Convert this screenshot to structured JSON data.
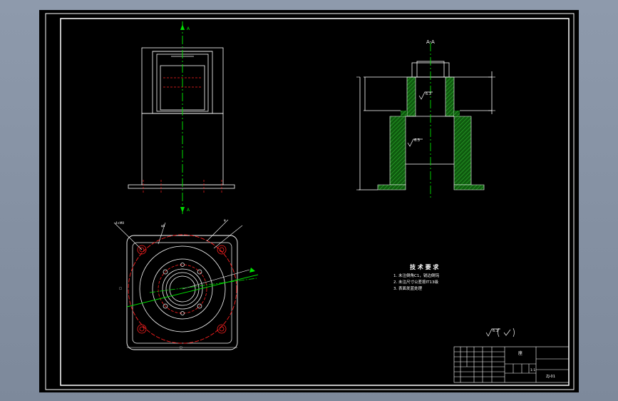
{
  "section_label": "A-A",
  "roughness_section": "6.3",
  "roughness_main": "6.3",
  "roughness_inner": "6.3",
  "default_roughness": "6.3",
  "tech_title": "技 术 要 求",
  "tech_lines": [
    "1. 未注倒角C1，锐边倒钝",
    "2. 未注尺寸公差按IT13级",
    "3. 表面发蓝处理"
  ],
  "title_block": {
    "part_name": "座",
    "scale": "1:1",
    "drawing_no": "ZJ-01"
  },
  "colors": {
    "background": "#000000",
    "outline": "#ffffff",
    "centerline": "#00ff00",
    "hidden": "#ff2020",
    "hatch": "#1e8c1e"
  }
}
